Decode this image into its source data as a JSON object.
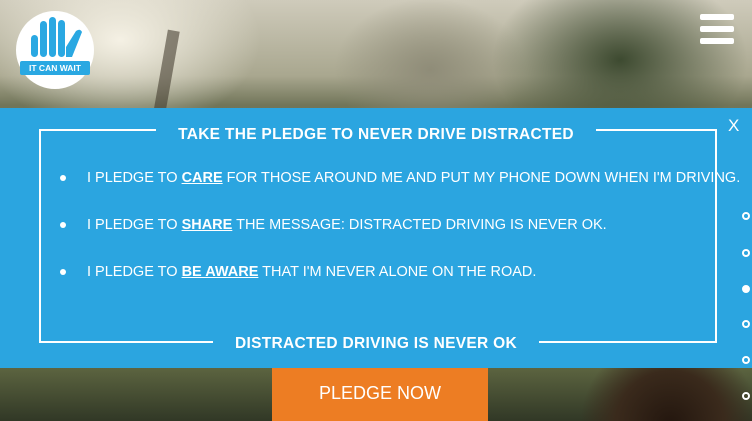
{
  "logo": {
    "text": "IT CAN WAIT",
    "brand_color": "#2aa8e2"
  },
  "header": {
    "menu_icon": "hamburger-menu-icon"
  },
  "modal": {
    "close_label": "X",
    "title": "TAKE THE PLEDGE TO NEVER DRIVE DISTRACTED",
    "pledges": [
      {
        "before": "I PLEDGE TO ",
        "keyword": "CARE",
        "after": " FOR THOSE AROUND ME AND PUT MY PHONE DOWN WHEN I'M DRIVING."
      },
      {
        "before": "I PLEDGE TO ",
        "keyword": "SHARE",
        "after": " THE MESSAGE: DISTRACTED DRIVING IS NEVER OK."
      },
      {
        "before": "I PLEDGE TO ",
        "keyword": "BE AWARE",
        "after": " THAT I'M NEVER ALONE ON THE ROAD."
      }
    ],
    "footer": "DISTRACTED DRIVING IS NEVER OK",
    "background_color": "#2ba5e0"
  },
  "cta": {
    "label": "PLEDGE NOW",
    "color": "#ed7d23"
  },
  "pagination": {
    "count": 6,
    "active_index": 2
  }
}
